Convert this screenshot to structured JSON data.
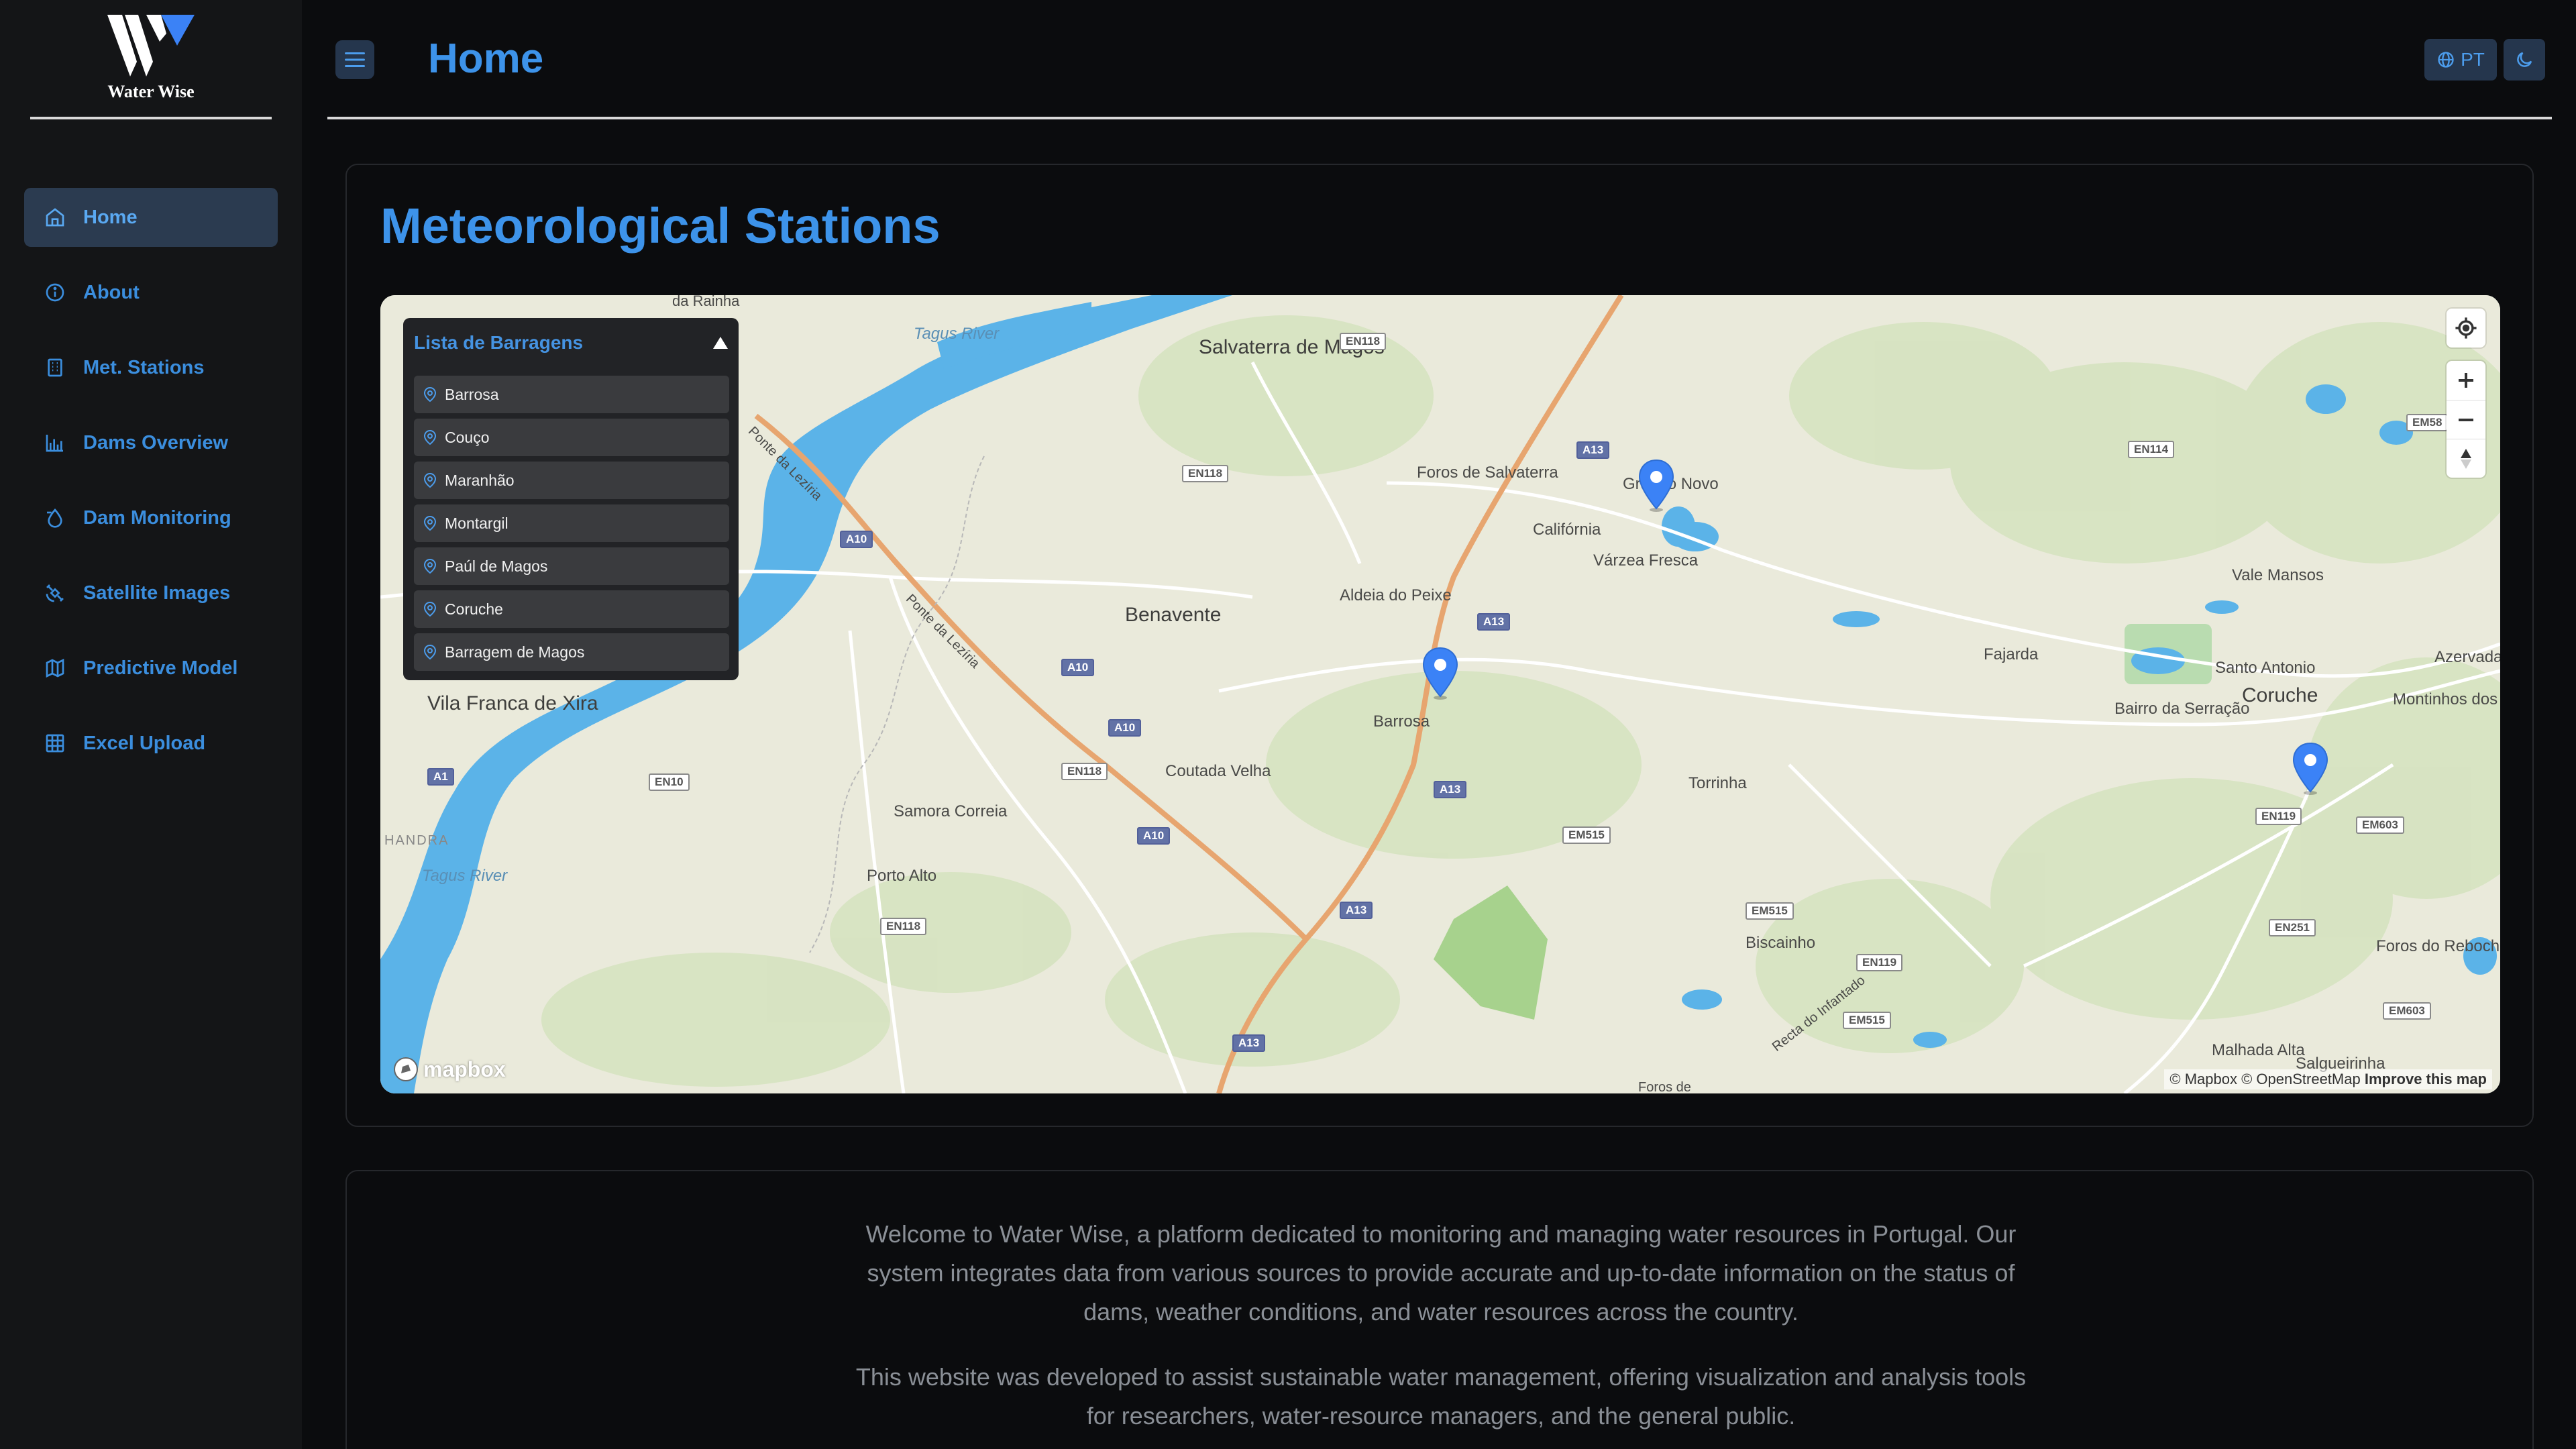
{
  "app": {
    "logo_text": "Water Wise"
  },
  "sidebar": {
    "items": [
      {
        "label": "Home",
        "icon": "home-icon",
        "active": true
      },
      {
        "label": "About",
        "icon": "info-icon"
      },
      {
        "label": "Met. Stations",
        "icon": "building-icon"
      },
      {
        "label": "Dams Overview",
        "icon": "dam-chart-icon"
      },
      {
        "label": "Dam Monitoring",
        "icon": "droplet-icon"
      },
      {
        "label": "Satellite Images",
        "icon": "satellite-icon"
      },
      {
        "label": "Predictive Model",
        "icon": "map-icon"
      },
      {
        "label": "Excel Upload",
        "icon": "table-icon"
      }
    ]
  },
  "header": {
    "title": "Home",
    "language": "PT"
  },
  "stations_card": {
    "title": "Meteorological Stations"
  },
  "map": {
    "dam_panel_title": "Lista de Barragens",
    "dams": [
      "Barrosa",
      "Couço",
      "Maranhão",
      "Montargil",
      "Paúl de Magos",
      "Coruche",
      "Barragem de Magos"
    ],
    "labels": {
      "salvaterra": "Salvaterra de Magos",
      "benavente": "Benavente",
      "vila_franca": "Vila Franca de Xira",
      "coruche": "Coruche",
      "barrosa": "Barrosa",
      "torrinha": "Torrinha",
      "samora": "Samora Correia",
      "porto_alto": "Porto Alto",
      "coutada": "Coutada Velha",
      "aldeia": "Aldeia do Peixe",
      "foros_salvaterra": "Foros de Salvaterra",
      "california": "Califórnia",
      "varzea": "Várzea Fresca",
      "granho": "Granho Novo",
      "fajarda": "Fajarda",
      "vale_mansos": "Vale Mansos",
      "santo_antonio": "Santo Antonio",
      "bairro": "Bairro da Serração",
      "biscainho": "Biscainho",
      "montinhos": "Montinhos dos Pegos",
      "azervada": "Azervada",
      "foros_rebocho": "Foros do Rebocho",
      "malhada": "Malhada Alta",
      "salgueirinha": "Salgueirinha",
      "tagus1": "Tagus River",
      "tagus2": "Tagus River",
      "ponte1": "Ponte da Lezíria",
      "ponte2": "Ponte da Lezíria",
      "recta": "Recta do Infantado",
      "da_rainha": "da Rainha",
      "handra": "HANDRA",
      "foros_de": "Foros de"
    },
    "roads": {
      "en118a": "EN118",
      "en118b": "EN118",
      "en118c": "EN118",
      "en118d": "EN118",
      "a13a": "A13",
      "a13b": "A13",
      "a13c": "A13",
      "a13d": "A13",
      "a13e": "A13",
      "a10a": "A10",
      "a10b": "A10",
      "a10c": "A10",
      "a10d": "A10",
      "en10": "EN10",
      "a1": "A1",
      "en114": "EN114",
      "em515a": "EM515",
      "em515b": "EM515",
      "em515c": "EM515",
      "en119a": "EN119",
      "en119b": "EN119",
      "en251": "EN251",
      "em603a": "EM603",
      "em603b": "EM603",
      "em58": "EM58"
    },
    "mapbox_logo": "mapbox",
    "attribution": "© Mapbox © OpenStreetMap",
    "improve": "Improve this map"
  },
  "welcome": {
    "p1": [
      "Welcome to Water Wise, a platform dedicated to monitoring and managing water resources in Portugal. Our",
      "system integrates data from various sources to provide accurate and up-to-date information on the status of",
      "dams, weather conditions, and water resources across the country."
    ],
    "p2": [
      "This website was developed to assist sustainable water management, offering visualization and analysis tools",
      "for researchers, water-resource managers, and the general public."
    ]
  },
  "colors": {
    "accent": "#3d93ea",
    "marker": "#3b82f6",
    "river": "#5bb3e8"
  }
}
